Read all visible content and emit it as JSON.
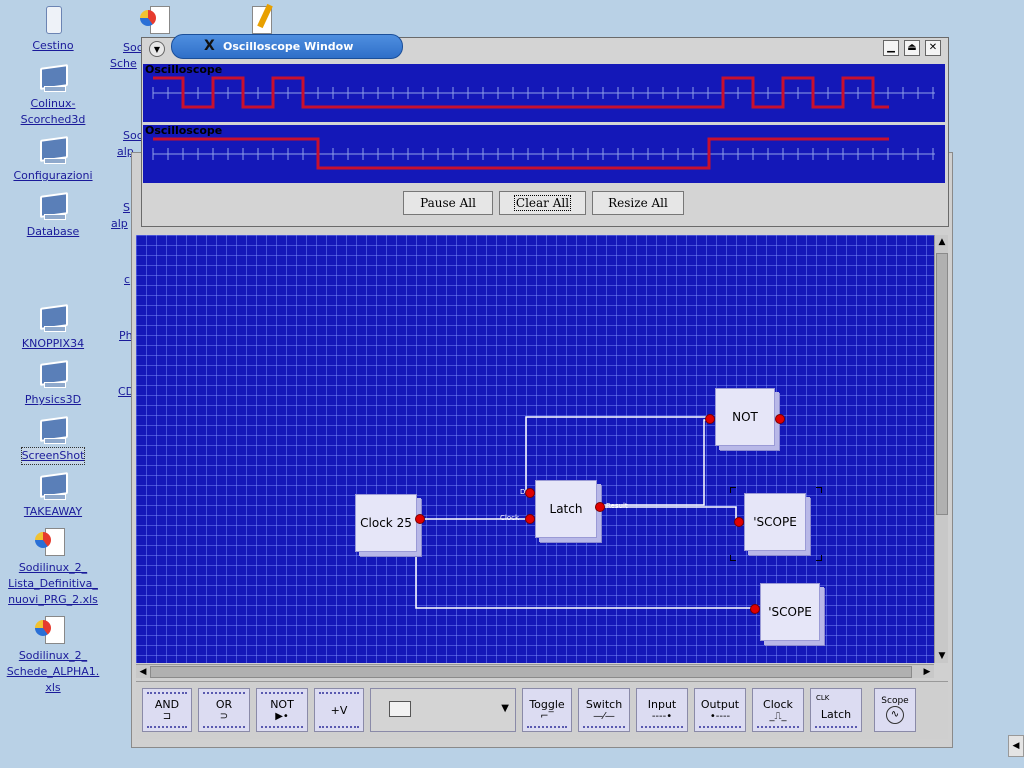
{
  "desktop": {
    "icons": [
      {
        "label": "Cestino"
      },
      {
        "label": "Colinux-Scorched3d"
      },
      {
        "label": "Configurazioni"
      },
      {
        "label": "Database"
      },
      {
        "label": "KNOPPIX34"
      },
      {
        "label": "Physics3D"
      },
      {
        "label": "ScreenShot"
      },
      {
        "label": "TAKEAWAY"
      },
      {
        "label": "Sodilinux_2_ Lista_Definitiva_ nuovi_PRG_2.xls"
      },
      {
        "label": "Sodilinux_2_ Schede_ALPHA1. xls"
      }
    ],
    "peek": [
      "Soc",
      "Sche",
      "Soc",
      "alp",
      "S",
      "alp",
      "c",
      "Ph",
      "CD"
    ]
  },
  "scope_window": {
    "title": "Oscilloscope Window",
    "traces": [
      {
        "name": "Oscilloscope"
      },
      {
        "name": "Oscilloscope"
      }
    ],
    "buttons": {
      "pause": "Pause All",
      "clear": "Clear All",
      "resize": "Resize All"
    }
  },
  "circuit": {
    "gates": {
      "clock": "Clock 25",
      "latch": "Latch",
      "not": "NOT",
      "scope1": "'SCOPE",
      "scope2": "'SCOPE"
    },
    "pin_labels": {
      "d": "D",
      "clock": "Clock",
      "result": "Result"
    }
  },
  "palette": {
    "and": "AND",
    "or": "OR",
    "not": "NOT",
    "vplus": "+V",
    "toggle": "Toggle",
    "switch": "Switch",
    "input": "Input",
    "output": "Output",
    "clock": "Clock",
    "latch_top": "CLK",
    "latch": "Latch",
    "scope": "Scope"
  },
  "colors": {
    "canvas": "#1418b8",
    "wire": "#ffffff",
    "pin": "#e00000",
    "trace": "#c8102e"
  }
}
